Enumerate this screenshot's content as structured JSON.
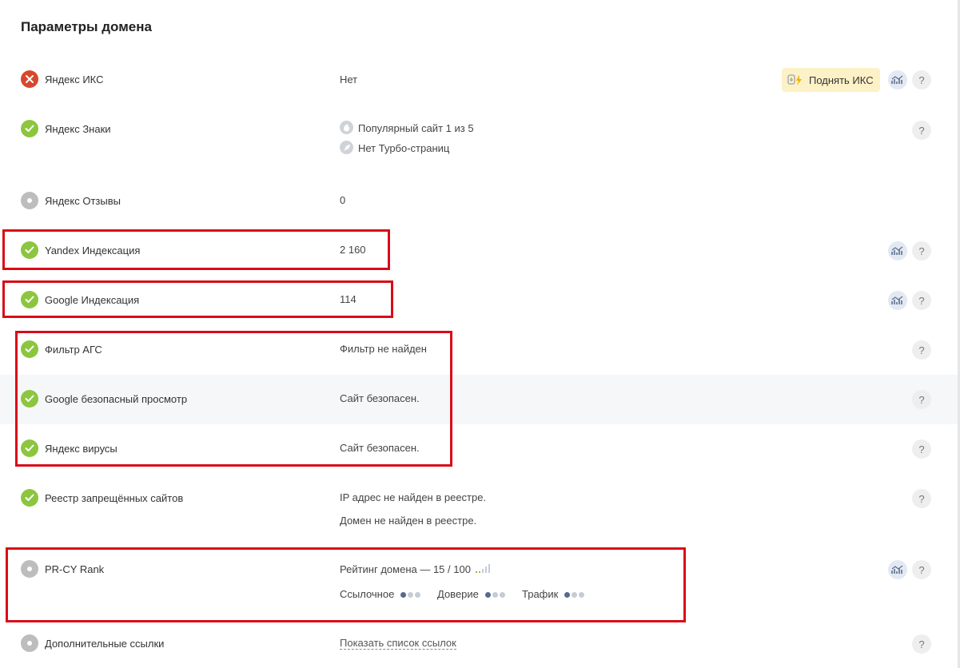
{
  "page": {
    "title": "Параметры домена"
  },
  "rows": {
    "iks": {
      "label": "Яндекс ИКС",
      "value": "Нет",
      "action": "Поднять ИКС"
    },
    "znaki": {
      "label": "Яндекс Знаки",
      "items": [
        "Популярный сайт 1 из 5",
        "Нет Турбо-страниц"
      ]
    },
    "otzyvy": {
      "label": "Яндекс Отзывы",
      "value": "0"
    },
    "yandex_index": {
      "label": "Yandex Индексация",
      "value": "2 160"
    },
    "google_index": {
      "label": "Google Индексация",
      "value": "114"
    },
    "ags": {
      "label": "Фильтр АГС",
      "value": "Фильтр не найден"
    },
    "google_safe": {
      "label": "Google безопасный просмотр",
      "value": "Сайт безопасен."
    },
    "yandex_virus": {
      "label": "Яндекс вирусы",
      "value": "Сайт безопасен."
    },
    "reestr": {
      "label": "Реестр запрещённых сайтов",
      "values": [
        "IP адрес не найден в реестре.",
        "Домен не найден в реестре."
      ]
    },
    "prcy": {
      "label": "PR-CY Rank",
      "rating": "Рейтинг домена — 15 / 100",
      "metrics": [
        {
          "label": "Ссылочное",
          "level": 1,
          "max": 3
        },
        {
          "label": "Доверие",
          "level": 1,
          "max": 3
        },
        {
          "label": "Трафик",
          "level": 1,
          "max": 3
        }
      ]
    },
    "extra_links": {
      "label": "Дополнительные ссылки",
      "link": "Показать список ссылок"
    }
  },
  "help_symbol": "?",
  "colors": {
    "ok": "#8cc63f",
    "error": "#d9472b",
    "na": "#bdbdbd",
    "highlight": "#d80c18",
    "raise_bg": "#fdf1c7"
  },
  "icons": {
    "ok": "check-icon",
    "error": "cross-icon",
    "na": "dot-icon",
    "chart": "chart-icon",
    "help": "question-icon"
  }
}
